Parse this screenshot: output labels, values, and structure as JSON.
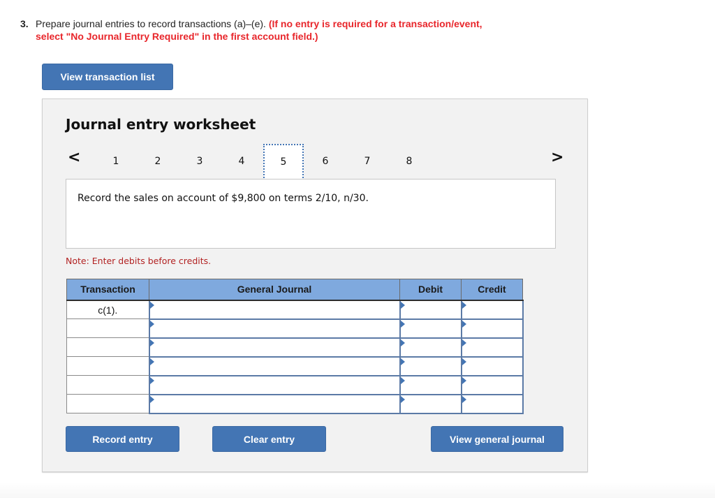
{
  "question": {
    "number": "3.",
    "text": "Prepare journal entries to record transactions (a)–(e).",
    "instruction_line1": "(If no entry is required for a transaction/event,",
    "instruction_line2": "select \"No Journal Entry Required\" in the first account field.)"
  },
  "buttons": {
    "view_transaction_list": "View transaction list",
    "record_entry": "Record entry",
    "clear_entry": "Clear entry",
    "view_general_journal": "View general journal"
  },
  "worksheet": {
    "title": "Journal entry worksheet",
    "pager": {
      "prev_icon": "chevron-left-icon",
      "next_icon": "chevron-right-icon",
      "tabs": [
        "1",
        "2",
        "3",
        "4",
        "5",
        "6",
        "7",
        "8"
      ],
      "active_tab": "5"
    },
    "description": "Record the sales on account of $9,800 on terms 2/10, n/30.",
    "note": "Note: Enter debits before credits."
  },
  "table": {
    "headers": [
      "Transaction",
      "General Journal",
      "Debit",
      "Credit"
    ],
    "rows": [
      {
        "transaction": "c(1).",
        "account": "",
        "debit": "",
        "credit": ""
      },
      {
        "transaction": "",
        "account": "",
        "debit": "",
        "credit": ""
      },
      {
        "transaction": "",
        "account": "",
        "debit": "",
        "credit": ""
      },
      {
        "transaction": "",
        "account": "",
        "debit": "",
        "credit": ""
      },
      {
        "transaction": "",
        "account": "",
        "debit": "",
        "credit": ""
      },
      {
        "transaction": "",
        "account": "",
        "debit": "",
        "credit": ""
      }
    ]
  },
  "colors": {
    "accent_button": "#4375b4",
    "table_header": "#7fa9de",
    "instruction_red": "#e8262b",
    "note_red": "#b22222",
    "panel_bg": "#f2f2f2"
  }
}
